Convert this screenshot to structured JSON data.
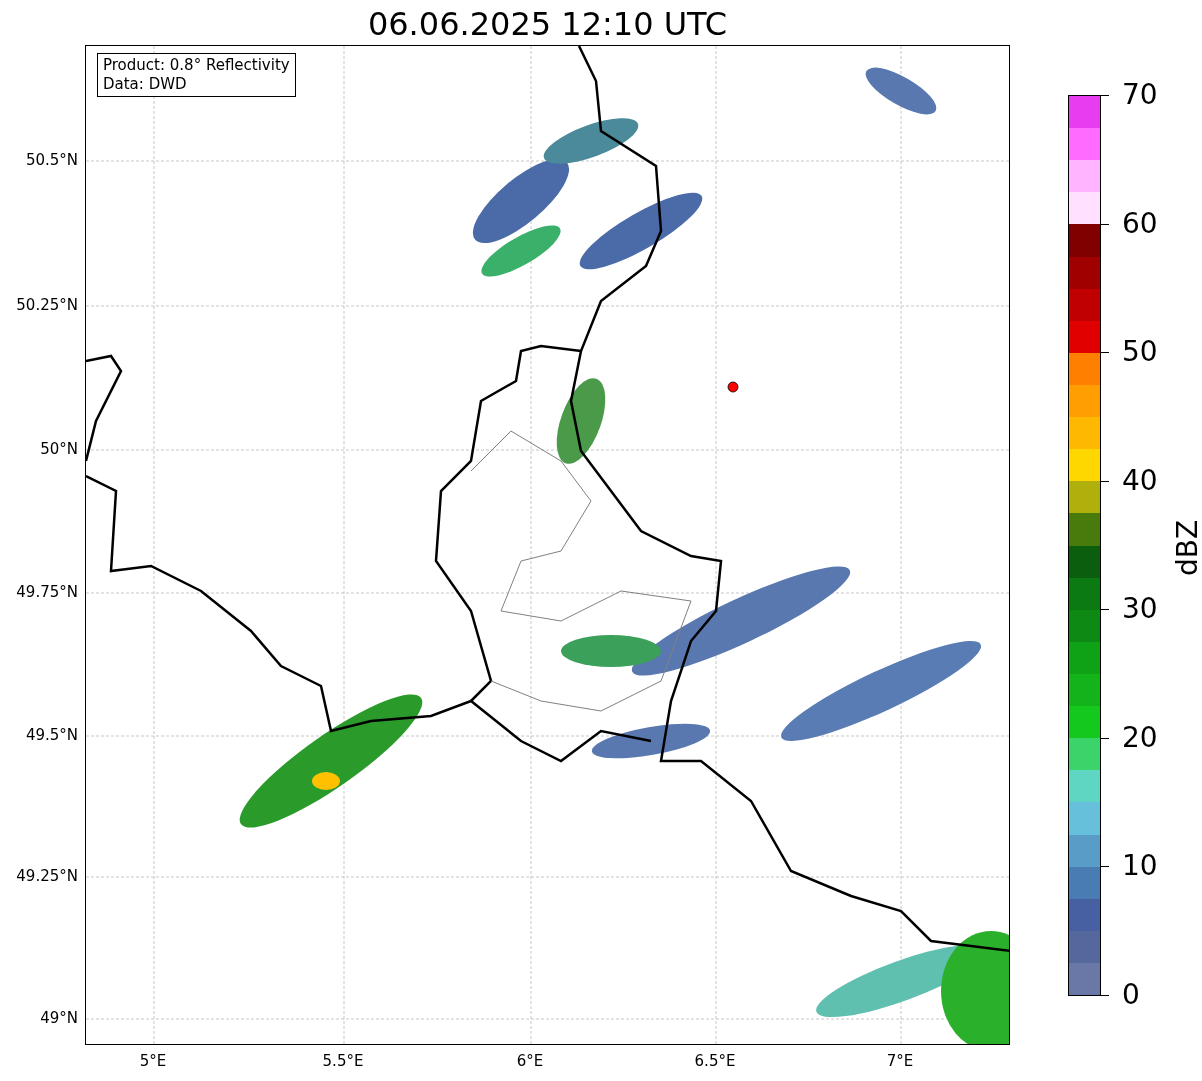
{
  "title": "06.06.2025 12:10 UTC",
  "info_box": [
    "Product: 0.8° Reflectivity",
    "Data: DWD"
  ],
  "map": {
    "y_tick_labels": [
      "50.5°N",
      "50.25°N",
      "50°N",
      "49.75°N",
      "49.5°N",
      "49.25°N",
      "49°N"
    ],
    "x_tick_labels": [
      "5°E",
      "5.5°E",
      "6°E",
      "6.5°E",
      "7°E"
    ]
  },
  "colorbar": {
    "label": "dBZ",
    "tick_labels": [
      "70",
      "60",
      "50",
      "40",
      "30",
      "20",
      "10",
      "0"
    ],
    "segments": [
      {
        "color": "#e83cf0"
      },
      {
        "color": "#ff6aff"
      },
      {
        "color": "#ffb4ff"
      },
      {
        "color": "#ffe0ff"
      },
      {
        "color": "#800000"
      },
      {
        "color": "#a00000"
      },
      {
        "color": "#c00000"
      },
      {
        "color": "#e00000"
      },
      {
        "color": "#ff8000"
      },
      {
        "color": "#ff9e00"
      },
      {
        "color": "#ffb800"
      },
      {
        "color": "#ffd700"
      },
      {
        "color": "#b0b00c"
      },
      {
        "color": "#487a0c"
      },
      {
        "color": "#0b5e0e"
      },
      {
        "color": "#0c7a12"
      },
      {
        "color": "#0e8a14"
      },
      {
        "color": "#10a216"
      },
      {
        "color": "#12b41a"
      },
      {
        "color": "#14c81e"
      },
      {
        "color": "#3ad46a"
      },
      {
        "color": "#5fd6c2"
      },
      {
        "color": "#66c0dc"
      },
      {
        "color": "#5a9cc8"
      },
      {
        "color": "#4a7cb4"
      },
      {
        "color": "#4660a2"
      },
      {
        "color": "#55689e"
      },
      {
        "color": "#6a78a8"
      }
    ]
  }
}
